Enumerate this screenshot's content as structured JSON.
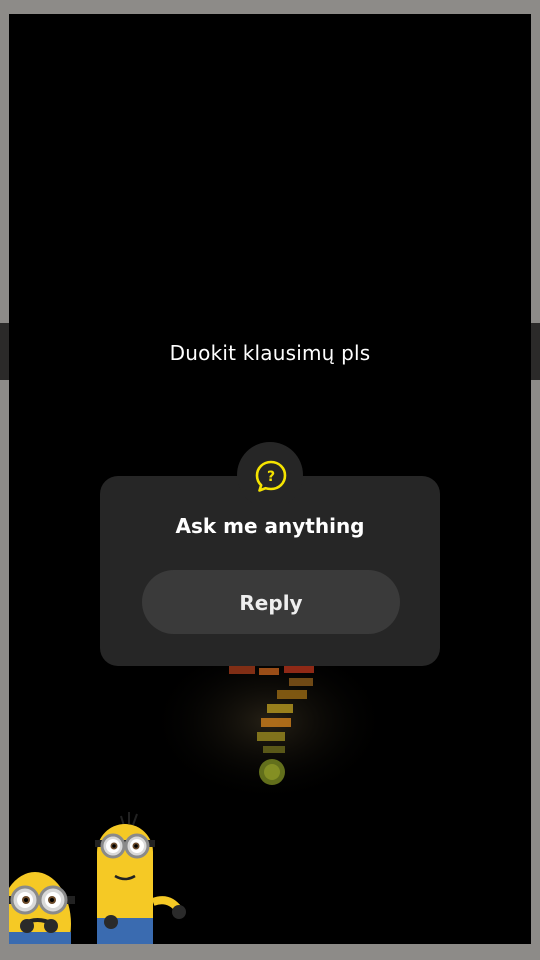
{
  "story": {
    "caption": "Duokit klausimų pls"
  },
  "question_sticker": {
    "icon": "question-bubble-icon",
    "title": "Ask me anything",
    "reply_label": "Reply",
    "accent_color": "#f5e400"
  },
  "decorations": {
    "background_art": "question-mark-word-cloud",
    "characters": [
      "minion-left",
      "minion-right"
    ]
  }
}
